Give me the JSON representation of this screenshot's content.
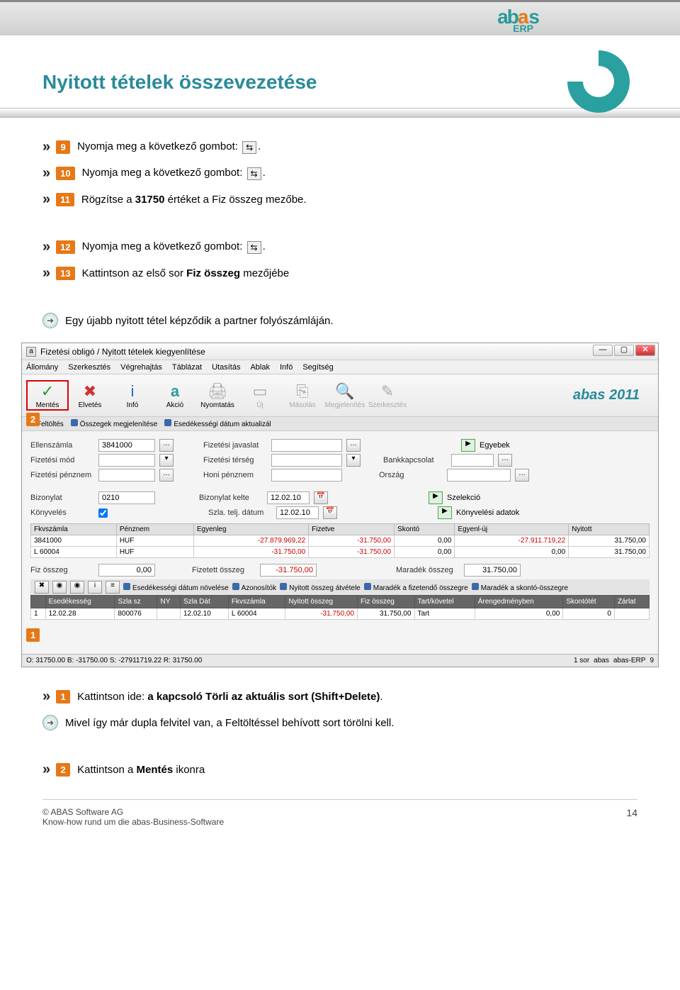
{
  "header": {
    "logo_brand": "abas",
    "logo_sub": "ERP"
  },
  "title": "Nyitott tételek összevezetése",
  "instructions": {
    "s9": {
      "num": "9",
      "text": "Nyomja meg a következő gombot: ",
      "icon": "⇆"
    },
    "s10": {
      "num": "10",
      "text": "Nyomja meg a következő gombot: ",
      "icon": "⇆"
    },
    "s11": {
      "num": "11",
      "text_a": "Rögzítse a ",
      "val": "31750",
      "text_b": " értéket a Fiz összeg mezőbe."
    },
    "s12": {
      "num": "12",
      "text": "Nyomja meg a következő gombot: ",
      "icon": "⇆"
    },
    "s13": {
      "num": "13",
      "text_a": "Kattintson az első sor   ",
      "bold": "Fiz összeg",
      "text_b": "  mezőjébe"
    },
    "note1": "Egy újabb nyitott tétel képződik a partner folyószámláján.",
    "b1": {
      "num": "1",
      "text_a": "Kattintson ide: ",
      "bold": "a kapcsoló Törli az aktuális sort (Shift+Delete)",
      "dot": "."
    },
    "note2": "Mivel így már dupla felvitel van, a Feltöltéssel behívott sort törölni kell.",
    "b2": {
      "num": "2",
      "text_a": "Kattintson  a ",
      "bold": "Mentés",
      "text_b": "  ikonra"
    }
  },
  "app": {
    "window_title": "Fizetési obligó / Nyitott tételek kiegyenlítése",
    "menus": [
      "Állomány",
      "Szerkesztés",
      "Végrehajtás",
      "Táblázat",
      "Utasítás",
      "Ablak",
      "Infó",
      "Segítség"
    ],
    "toolbar": {
      "mentes": "Mentés",
      "elvetes": "Elvetés",
      "info": "Infó",
      "akcio": "Akció",
      "nyomtatas": "Nyomtatás",
      "uj": "Új",
      "masolas": "Másolás",
      "megjelenites": "Megjelenítés",
      "szerkesztes": "Szerkesztés",
      "version": "abas 2011"
    },
    "subbar": {
      "feltoltes": "Feltöltés",
      "osszegek": "Összegek megjelenítése",
      "esedek": "Esedékességi dátum aktualizál"
    },
    "form": {
      "ellenszamla": "Ellenszámla",
      "ellenszamla_v": "3841000",
      "fizjavaslat": "Fizetési javaslat",
      "egyebek": "Egyebek",
      "fizmod": "Fizetési mód",
      "fizterseg": "Fizetési térség",
      "bankkapcs": "Bankkapcsolat",
      "fizpenznem": "Fizetési pénznem",
      "honipenznem": "Honi pénznem",
      "orszag": "Ország",
      "bizonylat": "Bizonylat",
      "bizonylat_v": "0210",
      "bizkelte": "Bizonylat kelte",
      "bizkelte_v": "12.02.10",
      "szelekcio": "Szelekció",
      "konyveles": "Könyvelés",
      "szlatelj": "Szla. telj. dátum",
      "szlatelj_v": "12.02.10",
      "konyvadatok": "Könyvelési adatok"
    },
    "grid1": {
      "cols": [
        "Fkvszámla",
        "Pénznem",
        "Egyenleg",
        "Fizetve",
        "Skontó",
        "Egyenl-új",
        "Nyitott"
      ],
      "rows": [
        {
          "fkv": "3841000",
          "penz": "HUF",
          "egyen": "-27.879.969,22",
          "fiz": "-31.750,00",
          "skonto": "0,00",
          "egyuj": "-27.911.719,22",
          "nyitott": "31.750,00"
        },
        {
          "fkv": "L 60004",
          "penz": "HUF",
          "egyen": "-31.750,00",
          "fiz": "-31.750,00",
          "skonto": "0,00",
          "egyuj": "0,00",
          "nyitott": "31.750,00"
        }
      ]
    },
    "totals": {
      "fizossz": "Fiz összeg",
      "fizossz_v": "0,00",
      "fizetett": "Fizetett összeg",
      "fizetett_v": "-31.750,00",
      "maradek": "Maradék összeg",
      "maradek_v": "31.750,00"
    },
    "rowtoolbar": {
      "esedek": "Esedékességi dátum növelése",
      "azon": "Azonosítók",
      "nyitottat": "Nyitott összeg átvétele",
      "maradekfiz": "Maradék a fizetendő összegre",
      "maradeksk": "Maradék a skontó-összegre"
    },
    "grid2": {
      "cols": [
        "",
        "Esedékesség",
        "Szla sz",
        "NY",
        "Szla Dát",
        "Fkvszámla",
        "Nyitott összeg",
        "Fiz összeg",
        "Tart/követel",
        "Árengedményben",
        "Skontótét",
        "Zárlat"
      ],
      "row": {
        "n": "1",
        "esedek": "12.02.28",
        "szlasz": "800076",
        "szladat": "12.02.10",
        "fkv": "L 60004",
        "nyitott": "-31.750,00",
        "fiz": "31.750,00",
        "tart": "Tart",
        "areng": "0,00",
        "skontotet": "0"
      }
    },
    "status": {
      "left": "O: 31750.00  B: -31750.00  S: -27911719.22  R: 31750.00",
      "sor": "1 sor",
      "user": "abas",
      "prod": "abas-ERP",
      "ver": "9"
    },
    "callouts": {
      "c1": "1",
      "c2": "2"
    }
  },
  "footer": {
    "copyright": "© ABAS Software AG",
    "tagline": "Know-how rund um die abas-Business-Software",
    "page": "14"
  }
}
